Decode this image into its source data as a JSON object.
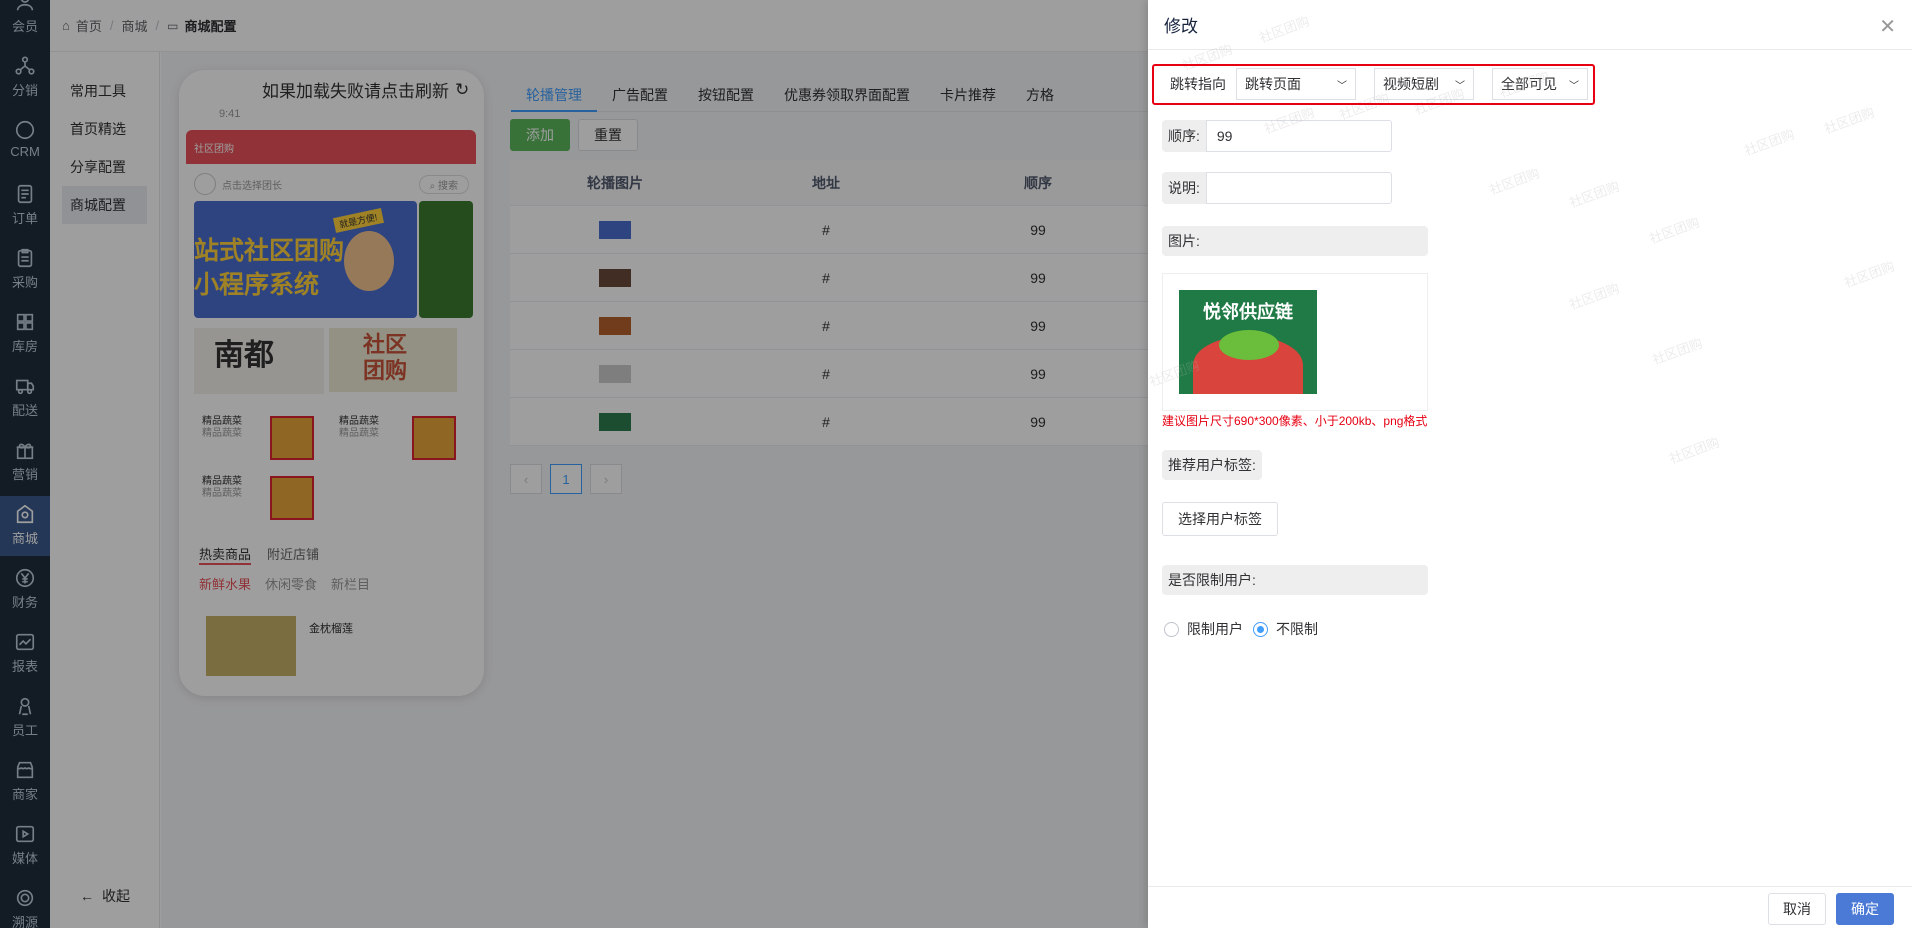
{
  "nav": [
    {
      "label": "会员",
      "icon": "user-icon"
    },
    {
      "label": "分销",
      "icon": "share-network-icon"
    },
    {
      "label": "CRM",
      "icon": "crm-icon"
    },
    {
      "label": "订单",
      "icon": "order-icon"
    },
    {
      "label": "采购",
      "icon": "clipboard-icon"
    },
    {
      "label": "库房",
      "icon": "warehouse-icon"
    },
    {
      "label": "配送",
      "icon": "truck-icon"
    },
    {
      "label": "营销",
      "icon": "gift-icon"
    },
    {
      "label": "商城",
      "icon": "store-icon"
    },
    {
      "label": "财务",
      "icon": "yen-icon"
    },
    {
      "label": "报表",
      "icon": "chart-icon"
    },
    {
      "label": "员工",
      "icon": "employee-icon"
    },
    {
      "label": "商家",
      "icon": "shop-icon"
    },
    {
      "label": "媒体",
      "icon": "media-play-icon"
    },
    {
      "label": "溯源",
      "icon": "trace-icon"
    }
  ],
  "breadcrumb": {
    "home": "首页",
    "mall": "商城",
    "current": "商城配置"
  },
  "submenu": [
    "常用工具",
    "首页精选",
    "分享配置",
    "商城配置"
  ],
  "collapse_label": "收起",
  "phone": {
    "hint": "如果加载失败请点击刷新",
    "time": "9:41",
    "header_title": "社区团购",
    "search_placeholder": "点击选择团长",
    "search_btn": "搜索",
    "banner_text1": "站式社区团购",
    "banner_text2": "小程序系统",
    "banner_badge": "就是方便!",
    "ad1": "南都",
    "ad2": "社区团购",
    "goods": [
      {
        "title": "精品蔬菜",
        "sub": "精品蔬菜"
      },
      {
        "title": "精品蔬菜",
        "sub": "精品蔬菜"
      },
      {
        "title": "精品蔬菜",
        "sub": "精品蔬菜"
      }
    ],
    "tab_hot": "热卖商品",
    "tab_near": "附近店铺",
    "cat1": "新鲜水果",
    "cat2": "休闲零食",
    "cat3": "新栏目",
    "product": "金枕榴莲"
  },
  "tabs": [
    "轮播管理",
    "广告配置",
    "按钮配置",
    "优惠券领取界面配置",
    "卡片推荐",
    "方格"
  ],
  "buttons": {
    "add": "添加",
    "reset": "重置"
  },
  "table": {
    "headers": [
      "轮播图片",
      "地址",
      "顺序"
    ],
    "rows": [
      {
        "addr": "#",
        "order": "99",
        "color": "#4a6fd1"
      },
      {
        "addr": "#",
        "order": "99",
        "color": "#6a4a3a"
      },
      {
        "addr": "#",
        "order": "99",
        "color": "#b5622e"
      },
      {
        "addr": "#",
        "order": "99",
        "color": "#cccccc"
      },
      {
        "addr": "#",
        "order": "99",
        "color": "#2e7d4f"
      }
    ]
  },
  "pager": {
    "prev": "‹",
    "page": "1",
    "next": "›"
  },
  "drawer": {
    "title": "修改",
    "jump_label": "跳转指向",
    "jump_page": "跳转页面",
    "video": "视频短剧",
    "visibility": "全部可见",
    "order_label": "顺序:",
    "order_value": "99",
    "desc_label": "说明:",
    "desc_value": "",
    "image_label": "图片:",
    "image_brand": "悦邻供应链",
    "image_hint": "建议图片尺寸690*300像素、小于200kb、png格式",
    "tag_label": "推荐用户标签:",
    "tag_btn": "选择用户标签",
    "limit_label": "是否限制用户:",
    "limit_opt1": "限制用户",
    "limit_opt2": "不限制",
    "cancel": "取消",
    "confirm": "确定"
  },
  "watermark": "社区团购",
  "colors": {
    "accent": "#409eff",
    "nav_bg": "#1f2d3d",
    "red_highlight": "#e60012",
    "hint_red": "#e60012",
    "confirm": "#4a7ad6"
  }
}
